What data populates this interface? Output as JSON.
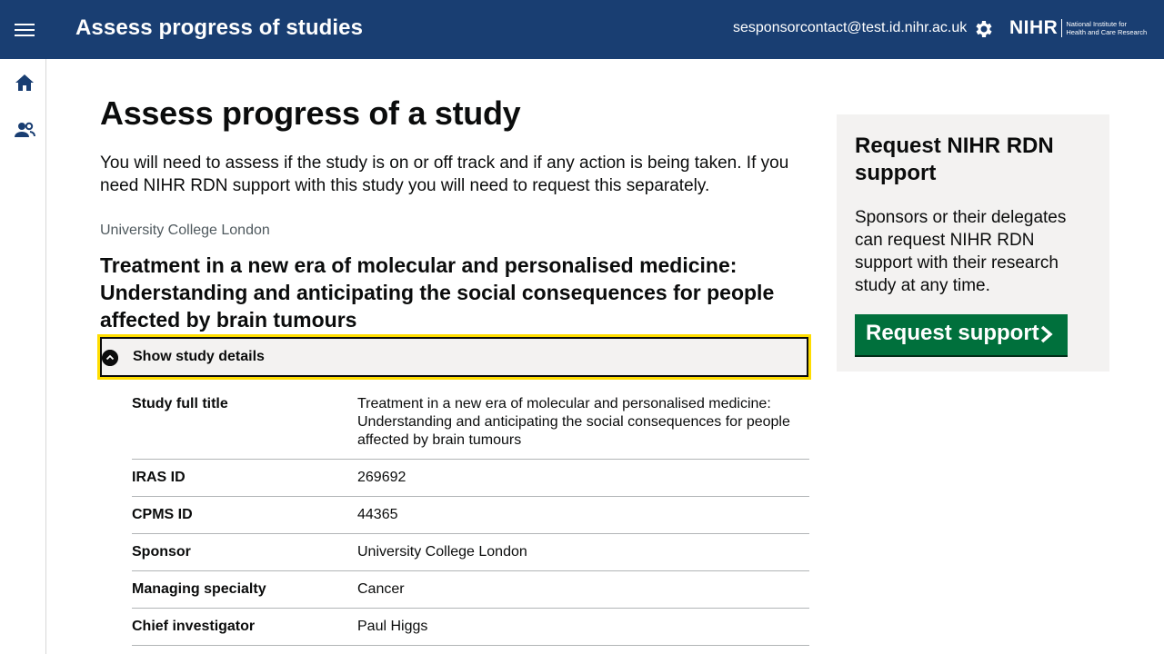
{
  "header": {
    "app_title": "Assess progress of studies",
    "user_email": "sesponsorcontact@test.id.nihr.ac.uk",
    "logo_main": "NIHR",
    "logo_sub_line1": "National Institute for",
    "logo_sub_line2": "Health and Care Research"
  },
  "main": {
    "page_title": "Assess progress of a study",
    "intro": "You will need to assess if the study is on or off track and if any action is being taken. If you need NIHR RDN support with this study you will need to request this separately.",
    "caption": "University College London",
    "study_title": "Treatment in a new era of molecular and personalised medicine: Understanding and anticipating the social consequences for people affected by brain tumours",
    "details_toggle": "Show study details",
    "summary": [
      {
        "key": "Study full title",
        "value": "Treatment in a new era of molecular and personalised medicine: Understanding and anticipating the social consequences for people affected by brain tumours"
      },
      {
        "key": "IRAS ID",
        "value": "269692"
      },
      {
        "key": "CPMS ID",
        "value": "44365"
      },
      {
        "key": "Sponsor",
        "value": "University College London"
      },
      {
        "key": "Managing specialty",
        "value": "Cancer"
      },
      {
        "key": "Chief investigator",
        "value": "Paul Higgs"
      }
    ]
  },
  "aside": {
    "title": "Request NIHR RDN support",
    "body": "Sponsors or their delegates can request NIHR RDN support with their research study at any time.",
    "button_label": "Request support"
  },
  "colors": {
    "header_bg": "#193e72",
    "focus": "#ffdd00",
    "button_green": "#00703c",
    "panel_bg": "#f3f2f1"
  },
  "icons": [
    "menu-icon",
    "settings-gear-icon",
    "home-icon",
    "users-icon",
    "chevron-up-icon",
    "chevron-right-icon"
  ]
}
